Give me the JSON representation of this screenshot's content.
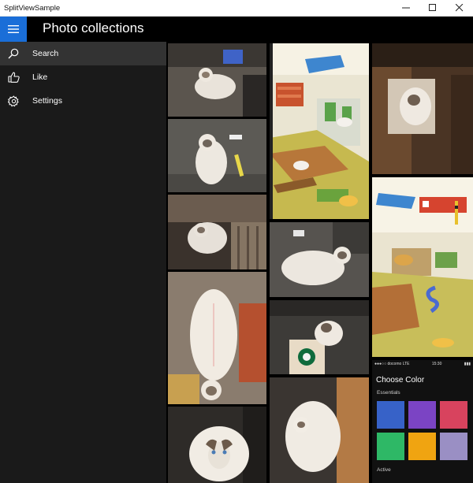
{
  "window": {
    "title": "SplitViewSample",
    "controls": [
      "minimize-icon",
      "maximize-icon",
      "close-icon"
    ]
  },
  "app": {
    "title": "Photo collections",
    "accent": "#1a6ed8"
  },
  "nav": {
    "items": [
      {
        "label": "Search",
        "icon": "search-icon",
        "selected": true
      },
      {
        "label": "Like",
        "icon": "thumbs-up-icon",
        "selected": false
      },
      {
        "label": "Settings",
        "icon": "gear-icon",
        "selected": false
      }
    ]
  },
  "phone_screenshot": {
    "carrier": "docomo",
    "network": "LTE",
    "time": "15:30",
    "heading": "Choose Color",
    "section": "Essentials",
    "footer": "Active",
    "swatches": [
      "#3762c8",
      "#7b44c4",
      "#d8435e",
      "#2eb866",
      "#f0a411",
      "#9a8fc4"
    ]
  }
}
